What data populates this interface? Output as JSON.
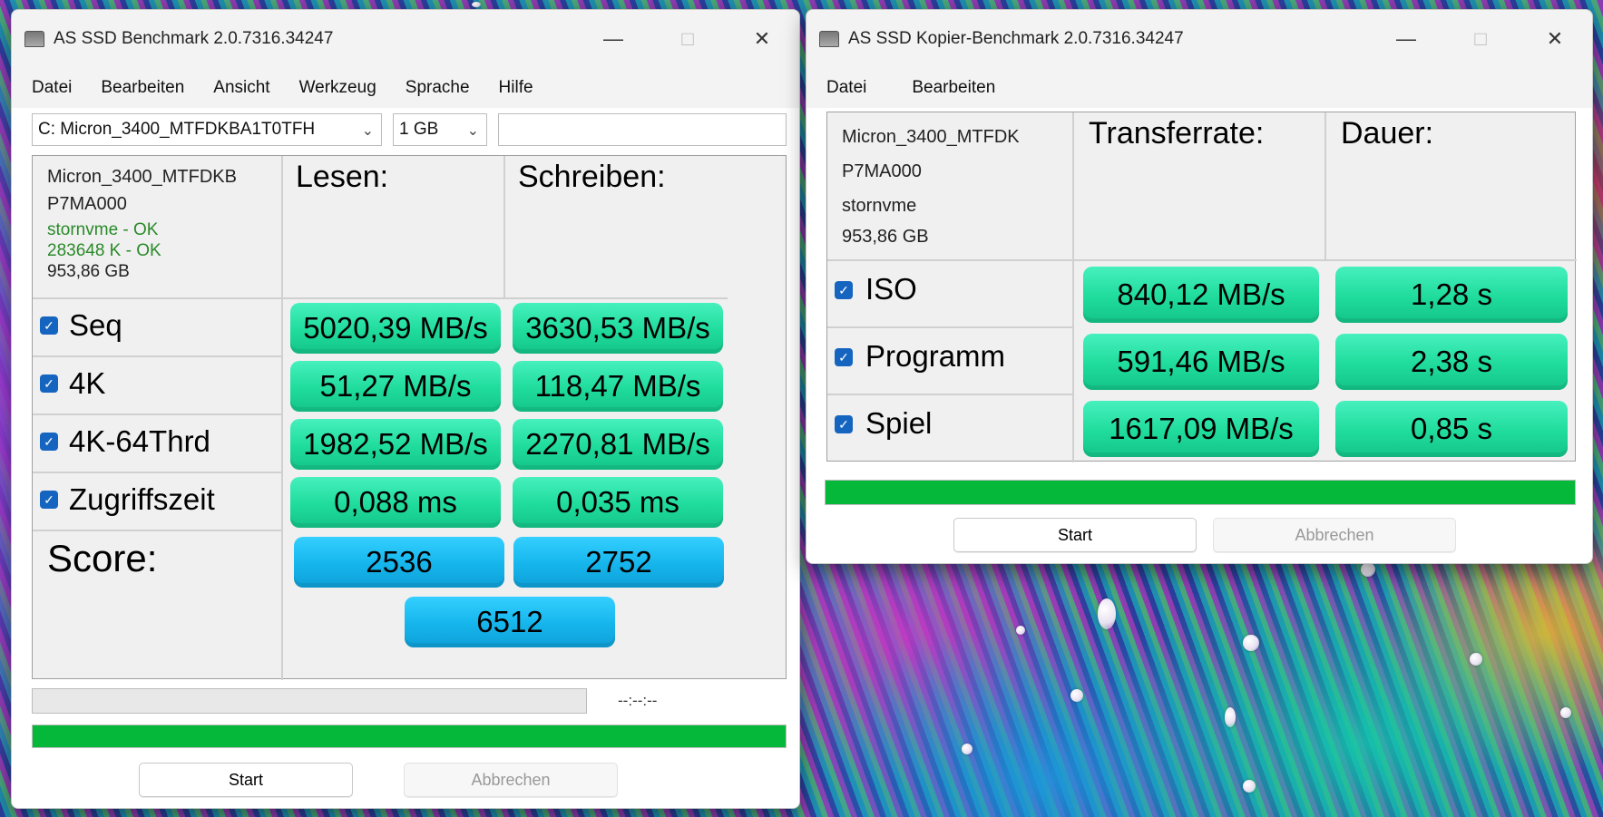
{
  "win1": {
    "title": "AS SSD Benchmark 2.0.7316.34247",
    "menu": [
      "Datei",
      "Bearbeiten",
      "Ansicht",
      "Werkzeug",
      "Sprache",
      "Hilfe"
    ],
    "drive_select": "C: Micron_3400_MTFDKBA1T0TFH",
    "size_select": "1 GB",
    "info": {
      "model": "Micron_3400_MTFDKB",
      "fw": "P7MA000",
      "driver": "stornvme - OK",
      "align": "283648 K - OK",
      "capacity": "953,86 GB"
    },
    "col_read": "Lesen:",
    "col_write": "Schreiben:",
    "rows": [
      {
        "label": "Seq",
        "read": "5020,39 MB/s",
        "write": "3630,53 MB/s"
      },
      {
        "label": "4K",
        "read": "51,27 MB/s",
        "write": "118,47 MB/s"
      },
      {
        "label": "4K-64Thrd",
        "read": "1982,52 MB/s",
        "write": "2270,81 MB/s"
      },
      {
        "label": "Zugriffszeit",
        "read": "0,088 ms",
        "write": "0,035 ms"
      }
    ],
    "score_label": "Score:",
    "score_read": "2536",
    "score_write": "2752",
    "score_total": "6512",
    "time": "--:--:--",
    "start": "Start",
    "cancel": "Abbrechen",
    "progress": 1.0
  },
  "win2": {
    "title": "AS SSD Kopier-Benchmark 2.0.7316.34247",
    "menu": [
      "Datei",
      "Bearbeiten"
    ],
    "info": {
      "model": "Micron_3400_MTFDK",
      "fw": "P7MA000",
      "driver": "stornvme",
      "capacity": "953,86 GB"
    },
    "col_rate": "Transferrate:",
    "col_time": "Dauer:",
    "rows": [
      {
        "label": "ISO",
        "rate": "840,12 MB/s",
        "time": "1,28 s"
      },
      {
        "label": "Programm",
        "rate": "591,46 MB/s",
        "time": "2,38 s"
      },
      {
        "label": "Spiel",
        "rate": "1617,09 MB/s",
        "time": "0,85 s"
      }
    ],
    "start": "Start",
    "cancel": "Abbrechen",
    "progress": 1.0
  }
}
